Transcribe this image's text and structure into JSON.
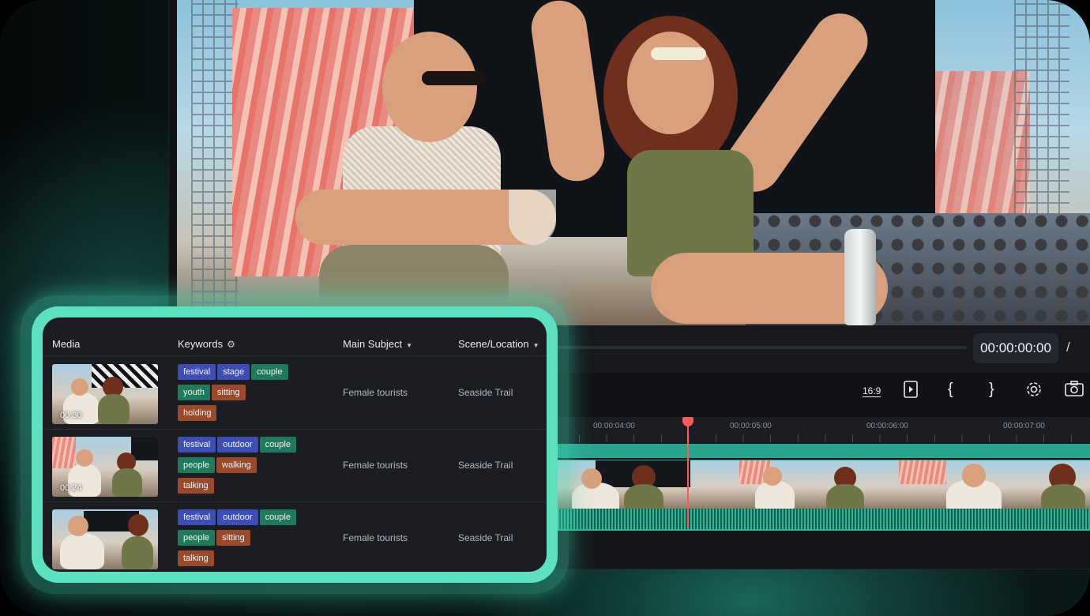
{
  "player": {
    "timecode": "00:00:00:00",
    "separator": "/",
    "toolbar": {
      "aspect_ratio": "16:9",
      "icons": [
        "aspect-ratio-icon",
        "preview-window-icon",
        "mark-in-icon",
        "mark-out-icon",
        "settings-icon",
        "snapshot-icon"
      ]
    }
  },
  "timeline": {
    "ruler_labels": [
      "00:00:04:00",
      "00:00:05:00",
      "00:00:06:00",
      "00:00:07:00"
    ]
  },
  "media_panel": {
    "columns": {
      "media": "Media",
      "keywords": "Keywords",
      "main_subject": "Main Subject",
      "scene_location": "Scene/Location"
    },
    "rows": [
      {
        "duration": "00:30",
        "tags": [
          "festival",
          "stage",
          "couple",
          "youth",
          "sitting",
          "holding"
        ],
        "main_subject": "Female tourists",
        "scene_location": "Seaside Trail"
      },
      {
        "duration": "00:24",
        "tags": [
          "festival",
          "outdoor",
          "couple",
          "people",
          "walking",
          "talking"
        ],
        "main_subject": "Female tourists",
        "scene_location": "Seaside Trail"
      },
      {
        "duration": "",
        "tags": [
          "festival",
          "outdoor",
          "couple",
          "people",
          "sitting",
          "talking"
        ],
        "main_subject": "Female tourists",
        "scene_location": "Seaside Trail"
      }
    ]
  },
  "colors": {
    "accent": "#5de0c0",
    "timeline_clip": "#2aa58d",
    "playhead": "#ff5a57",
    "tag_blue": "#3d4fb5",
    "tag_green": "#1f7a5c",
    "tag_orange": "#9a4a2a"
  }
}
